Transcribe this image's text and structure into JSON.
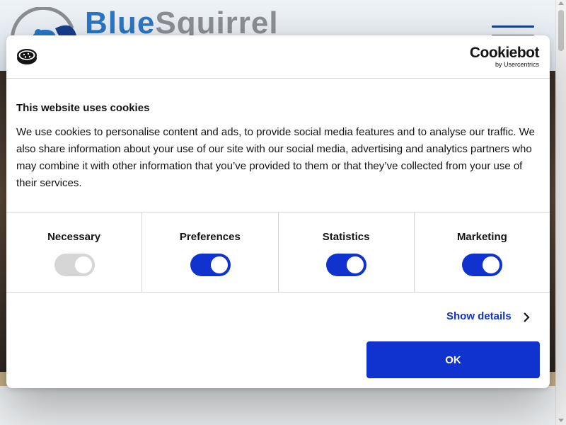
{
  "site": {
    "logo_blue": "Blue",
    "logo_grey": "Squirrel",
    "brand_color": "#2a76c5"
  },
  "cookie_dialog": {
    "brand_name": "Cookiebot",
    "brand_sub": "by Usercentrics",
    "title": "This website uses cookies",
    "body": "We use cookies to personalise content and ads, to provide social media features and to analyse our traffic. We also share information about your use of our site with our social media, advertising and analytics partners who may combine it with other information that you’ve provided to them or that they’ve collected from your use of their services.",
    "categories": [
      {
        "label": "Necessary",
        "checked": true,
        "disabled": true
      },
      {
        "label": "Preferences",
        "checked": true,
        "disabled": false
      },
      {
        "label": "Statistics",
        "checked": true,
        "disabled": false
      },
      {
        "label": "Marketing",
        "checked": true,
        "disabled": false
      }
    ],
    "show_details_label": "Show details",
    "ok_label": "OK",
    "accent_color": "#1032cf"
  }
}
